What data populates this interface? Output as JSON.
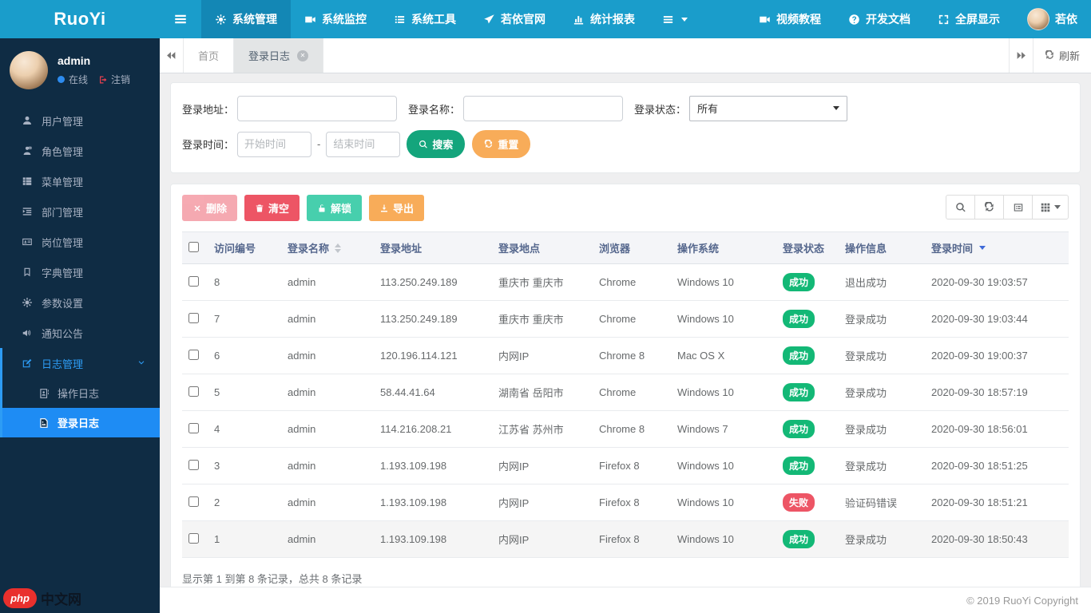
{
  "brand": {
    "logo": "RuoYi"
  },
  "topnav": {
    "items": [
      {
        "name": "system-management",
        "label": "系统管理",
        "icon": "gear",
        "active": true
      },
      {
        "name": "system-monitor",
        "label": "系统监控",
        "icon": "video"
      },
      {
        "name": "system-tools",
        "label": "系统工具",
        "icon": "list"
      },
      {
        "name": "ruoyi-website",
        "label": "若依官网",
        "icon": "send"
      },
      {
        "name": "statistics-report",
        "label": "统计报表",
        "icon": "chart"
      },
      {
        "name": "more-menu",
        "label": "",
        "icon": "bars",
        "caret": true
      }
    ],
    "right": [
      {
        "name": "video-tutorial",
        "label": "视频教程",
        "icon": "video"
      },
      {
        "name": "dev-docs",
        "label": "开发文档",
        "icon": "question"
      },
      {
        "name": "fullscreen",
        "label": "全屏显示",
        "icon": "expand"
      },
      {
        "name": "profile",
        "label": "若依",
        "icon": "avatar"
      }
    ]
  },
  "user": {
    "name": "admin",
    "status_label": "在线",
    "logout_label": "注销"
  },
  "menu": {
    "items": [
      {
        "name": "user-management",
        "label": "用户管理",
        "icon": "user"
      },
      {
        "name": "role-management",
        "label": "角色管理",
        "icon": "role"
      },
      {
        "name": "menu-management",
        "label": "菜单管理",
        "icon": "thlist"
      },
      {
        "name": "dept-management",
        "label": "部门管理",
        "icon": "dept"
      },
      {
        "name": "post-management",
        "label": "岗位管理",
        "icon": "idcard"
      },
      {
        "name": "dict-management",
        "label": "字典管理",
        "icon": "bookmark"
      },
      {
        "name": "param-settings",
        "label": "参数设置",
        "icon": "gear"
      },
      {
        "name": "notice",
        "label": "通知公告",
        "icon": "bullhorn"
      },
      {
        "name": "log-management",
        "label": "日志管理",
        "icon": "edit",
        "expanded": true,
        "children": [
          {
            "name": "operation-log",
            "label": "操作日志",
            "icon": "addrbook"
          },
          {
            "name": "login-log",
            "label": "登录日志",
            "icon": "fileimg",
            "active": true
          }
        ]
      }
    ]
  },
  "tabs": {
    "home": "首页",
    "current": "登录日志",
    "refresh_label": "刷新"
  },
  "search": {
    "addr_label": "登录地址：",
    "name_label": "登录名称：",
    "status_label": "登录状态：",
    "status_value": "所有",
    "time_label": "登录时间：",
    "start_placeholder": "开始时间",
    "end_placeholder": "结束时间",
    "separator": "-",
    "search_label": "搜索",
    "reset_label": "重置"
  },
  "toolbar": {
    "delete_label": "删除",
    "clean_label": "清空",
    "unlock_label": "解锁",
    "export_label": "导出"
  },
  "table": {
    "headers": [
      {
        "label": "访问编号"
      },
      {
        "label": "登录名称",
        "sort": "both"
      },
      {
        "label": "登录地址"
      },
      {
        "label": "登录地点"
      },
      {
        "label": "浏览器"
      },
      {
        "label": "操作系统"
      },
      {
        "label": "登录状态"
      },
      {
        "label": "操作信息"
      },
      {
        "label": "登录时间",
        "sort": "desc"
      }
    ],
    "rows": [
      {
        "id": "8",
        "name": "admin",
        "ip": "113.250.249.189",
        "location": "重庆市 重庆市",
        "browser": "Chrome",
        "os": "Windows 10",
        "status": "成功",
        "status_type": "success",
        "message": "退出成功",
        "time": "2020-09-30 19:03:57"
      },
      {
        "id": "7",
        "name": "admin",
        "ip": "113.250.249.189",
        "location": "重庆市 重庆市",
        "browser": "Chrome",
        "os": "Windows 10",
        "status": "成功",
        "status_type": "success",
        "message": "登录成功",
        "time": "2020-09-30 19:03:44"
      },
      {
        "id": "6",
        "name": "admin",
        "ip": "120.196.114.121",
        "location": "内网IP",
        "browser": "Chrome 8",
        "os": "Mac OS X",
        "status": "成功",
        "status_type": "success",
        "message": "登录成功",
        "time": "2020-09-30 19:00:37"
      },
      {
        "id": "5",
        "name": "admin",
        "ip": "58.44.41.64",
        "location": "湖南省 岳阳市",
        "browser": "Chrome",
        "os": "Windows 10",
        "status": "成功",
        "status_type": "success",
        "message": "登录成功",
        "time": "2020-09-30 18:57:19"
      },
      {
        "id": "4",
        "name": "admin",
        "ip": "114.216.208.21",
        "location": "江苏省 苏州市",
        "browser": "Chrome 8",
        "os": "Windows 7",
        "status": "成功",
        "status_type": "success",
        "message": "登录成功",
        "time": "2020-09-30 18:56:01"
      },
      {
        "id": "3",
        "name": "admin",
        "ip": "1.193.109.198",
        "location": "内网IP",
        "browser": "Firefox 8",
        "os": "Windows 10",
        "status": "成功",
        "status_type": "success",
        "message": "登录成功",
        "time": "2020-09-30 18:51:25"
      },
      {
        "id": "2",
        "name": "admin",
        "ip": "1.193.109.198",
        "location": "内网IP",
        "browser": "Firefox 8",
        "os": "Windows 10",
        "status": "失败",
        "status_type": "danger",
        "message": "验证码错误",
        "time": "2020-09-30 18:51:21"
      },
      {
        "id": "1",
        "name": "admin",
        "ip": "1.193.109.198",
        "location": "内网IP",
        "browser": "Firefox 8",
        "os": "Windows 10",
        "status": "成功",
        "status_type": "success",
        "message": "登录成功",
        "time": "2020-09-30 18:50:43",
        "striped": true
      }
    ]
  },
  "summary": "显示第 1 到第 8 条记录，总共 8 条记录",
  "footer": {
    "copyright": "© 2019 RuoYi Copyright"
  },
  "watermark": {
    "php": "php",
    "cn": "中文网"
  }
}
